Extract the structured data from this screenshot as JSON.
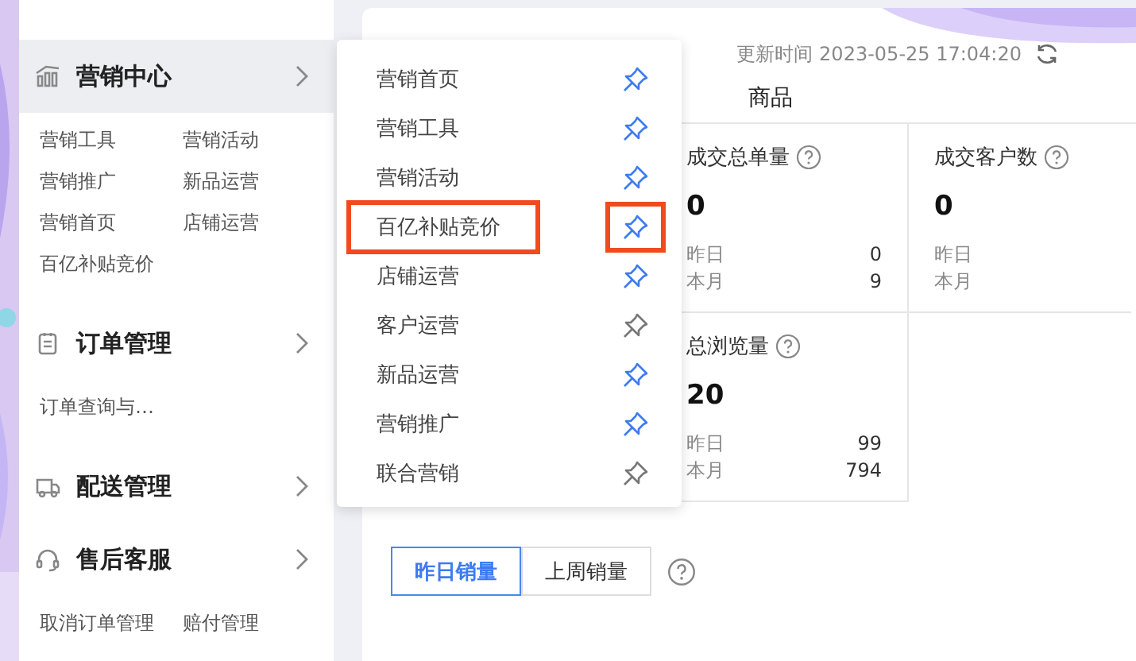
{
  "sidebar": {
    "sections": [
      {
        "title": "营销中心",
        "hovered": true,
        "links": [
          "营销工具",
          "营销活动",
          "营销推广",
          "新品运营",
          "营销首页",
          "店铺运营",
          "百亿补贴竞价"
        ]
      },
      {
        "title": "订单管理",
        "hovered": false,
        "links": [
          "订单查询与…"
        ]
      },
      {
        "title": "配送管理",
        "hovered": false
      },
      {
        "title": "售后客服",
        "hovered": false,
        "links": [
          "取消订单管理",
          "赔付管理"
        ]
      }
    ]
  },
  "popup_menu": {
    "items": [
      {
        "label": "营销首页",
        "pinned": true,
        "highlighted": false
      },
      {
        "label": "营销工具",
        "pinned": true,
        "highlighted": false
      },
      {
        "label": "营销活动",
        "pinned": true,
        "highlighted": false
      },
      {
        "label": "百亿补贴竞价",
        "pinned": true,
        "highlighted": true
      },
      {
        "label": "店铺运营",
        "pinned": true,
        "highlighted": false
      },
      {
        "label": "客户运营",
        "pinned": false,
        "highlighted": false
      },
      {
        "label": "新品运营",
        "pinned": true,
        "highlighted": false
      },
      {
        "label": "营销推广",
        "pinned": true,
        "highlighted": false
      },
      {
        "label": "联合营销",
        "pinned": false,
        "highlighted": false
      }
    ]
  },
  "header": {
    "update_time": "更新时间 2023-05-25 17:04:20"
  },
  "tabs": [
    {
      "label": "商品",
      "selected": false
    }
  ],
  "metrics": [
    {
      "title": "成交总单量",
      "value": "0",
      "rows": [
        {
          "label": "昨日",
          "value": "0"
        },
        {
          "label": "本月",
          "value": "9"
        }
      ]
    },
    {
      "title": "成交客户数",
      "value": "0",
      "rows": [
        {
          "label": "昨日"
        },
        {
          "label": "本月"
        }
      ]
    },
    {
      "title": "总浏览量",
      "value": "20",
      "rows": [
        {
          "label": "昨日",
          "value": "99"
        },
        {
          "label": "本月",
          "value": "794"
        }
      ]
    }
  ],
  "sales_toggle": [
    {
      "label": "昨日销量",
      "selected": true
    },
    {
      "label": "上周销量",
      "selected": false
    }
  ]
}
